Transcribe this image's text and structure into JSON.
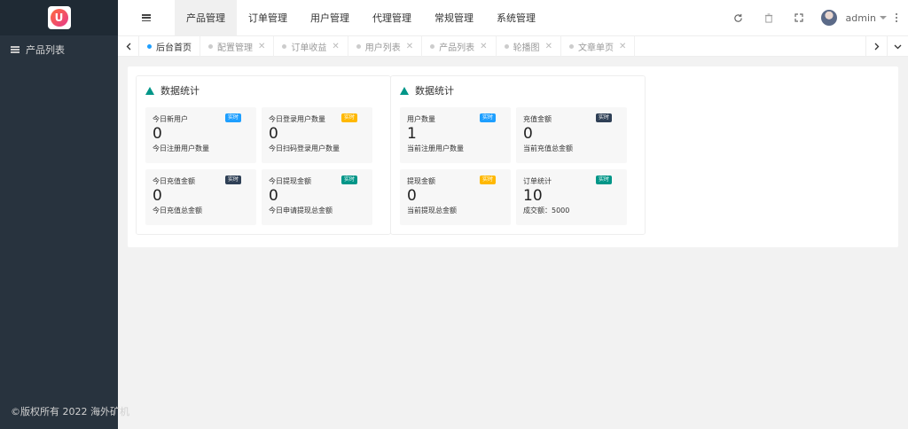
{
  "sidebar": {
    "items": [
      {
        "label": "产品列表"
      }
    ],
    "copyright": "©版权所有 2022 海外矿机"
  },
  "header": {
    "nav": [
      "产品管理",
      "订单管理",
      "用户管理",
      "代理管理",
      "常规管理",
      "系统管理"
    ],
    "active_nav": 0,
    "icons": [
      "refresh-icon",
      "trash-icon",
      "fullscreen-icon"
    ],
    "user": "admin"
  },
  "tabs": [
    {
      "label": "后台首页",
      "closable": false,
      "active": true
    },
    {
      "label": "配置管理",
      "closable": true
    },
    {
      "label": "订单收益",
      "closable": true
    },
    {
      "label": "用户列表",
      "closable": true
    },
    {
      "label": "产品列表",
      "closable": true
    },
    {
      "label": "轮播图",
      "closable": true
    },
    {
      "label": "文章单页",
      "closable": true
    }
  ],
  "panels": [
    {
      "title": "数据统计",
      "cards": [
        {
          "label": "今日新用户",
          "value": "0",
          "desc": "今日注册用户数量",
          "badge": "实时",
          "badge_color": "#1e9fff"
        },
        {
          "label": "今日登录用户数量",
          "value": "0",
          "desc": "今日扫码登录用户数量",
          "badge": "实时",
          "badge_color": "#ffb800"
        },
        {
          "label": "今日充值金额",
          "value": "0",
          "desc": "今日充值总金额",
          "badge": "实时",
          "badge_color": "#2f4056"
        },
        {
          "label": "今日提现金额",
          "value": "0",
          "desc": "今日申请提现总金额",
          "badge": "实时",
          "badge_color": "#009688"
        }
      ]
    },
    {
      "title": "数据统计",
      "cards": [
        {
          "label": "用户数量",
          "value": "1",
          "desc": "当前注册用户数量",
          "badge": "实时",
          "badge_color": "#1e9fff"
        },
        {
          "label": "充值金额",
          "value": "0",
          "desc": "当前充值总金额",
          "badge": "实时",
          "badge_color": "#2f4056"
        },
        {
          "label": "提现金额",
          "value": "0",
          "desc": "当前提现总金额",
          "badge": "实时",
          "badge_color": "#ffb800"
        },
        {
          "label": "订单统计",
          "value": "10",
          "desc": "成交额：5000",
          "badge": "实时",
          "badge_color": "#009688"
        }
      ]
    }
  ]
}
